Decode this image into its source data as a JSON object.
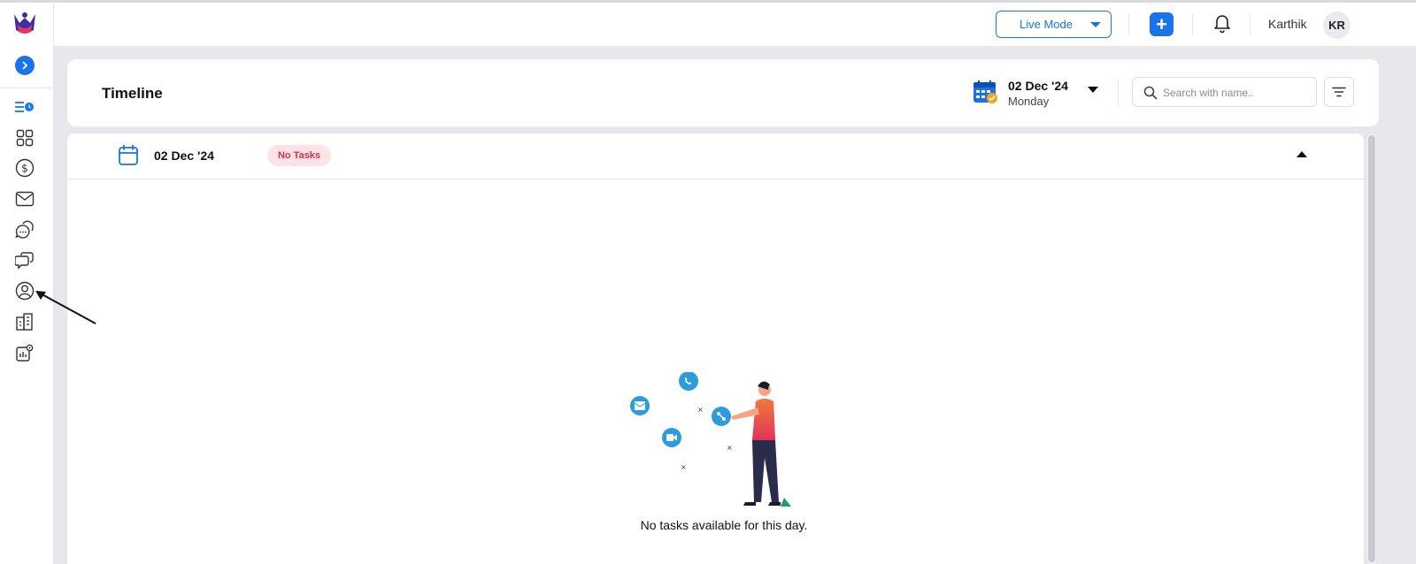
{
  "topbar": {
    "mode_label": "Live Mode",
    "add_label": "+",
    "user_name": "Karthik",
    "user_initials": "KR"
  },
  "sidebar": {
    "items": [
      {
        "icon": "timeline-icon",
        "active": true
      },
      {
        "icon": "grid-icon"
      },
      {
        "icon": "dollar-icon"
      },
      {
        "icon": "mail-icon"
      },
      {
        "icon": "chat-bubbles-icon"
      },
      {
        "icon": "conversation-icon"
      },
      {
        "icon": "user-circle-icon"
      },
      {
        "icon": "building-icon"
      },
      {
        "icon": "analytics-settings-icon"
      }
    ]
  },
  "header": {
    "title": "Timeline",
    "date": "02 Dec '24",
    "weekday": "Monday",
    "search_placeholder": "Search with name.."
  },
  "timeline": {
    "day_date": "02 Dec '24",
    "status_badge": "No Tasks",
    "empty_message": "No tasks available for this day."
  },
  "colors": {
    "accent": "#1a73e8",
    "badge_bg": "#fde2e6",
    "badge_text": "#d9304f",
    "canvas": "#e8e8ec"
  }
}
